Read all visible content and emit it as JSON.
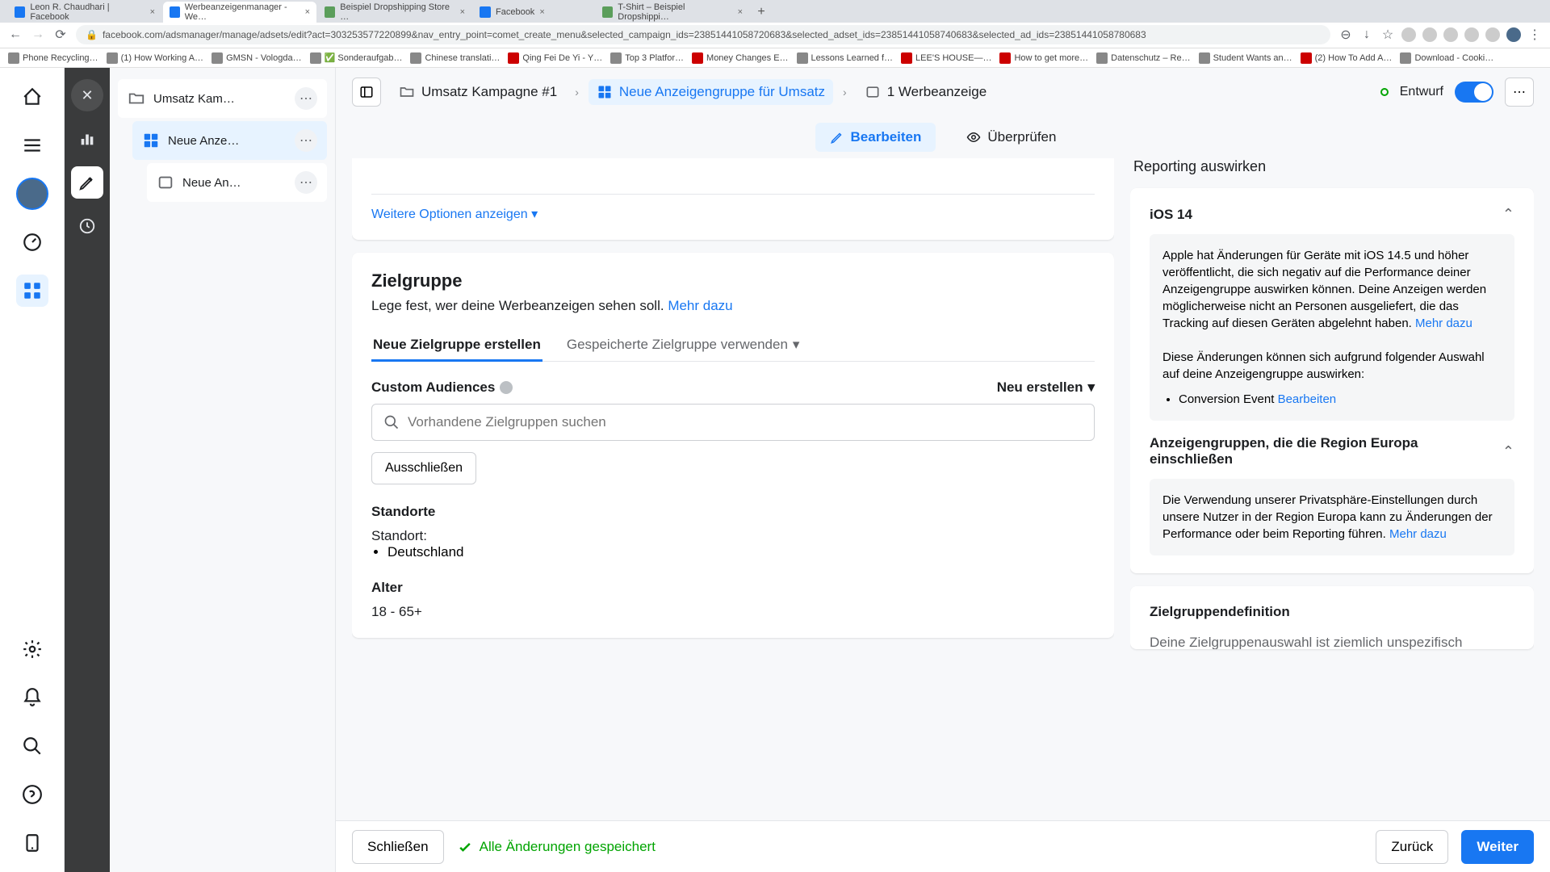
{
  "browser": {
    "tabs": [
      {
        "label": "Leon R. Chaudhari | Facebook",
        "favicon": "#1877f2"
      },
      {
        "label": "Werbeanzeigenmanager - We…",
        "favicon": "#1877f2"
      },
      {
        "label": "Beispiel Dropshipping Store …",
        "favicon": "#5b9e5b"
      },
      {
        "label": "Facebook",
        "favicon": "#1877f2"
      },
      {
        "label": "T-Shirt – Beispiel Dropshippi…",
        "favicon": "#5b9e5b"
      }
    ],
    "url": "facebook.com/adsmanager/manage/adsets/edit?act=303253577220899&nav_entry_point=comet_create_menu&selected_campaign_ids=23851441058720683&selected_adset_ids=23851441058740683&selected_ad_ids=23851441058780683",
    "bookmarks": [
      "Phone Recycling…",
      "(1) How Working A…",
      "GMSN - Vologda…",
      "✅ Sonderaufgab…",
      "Chinese translati…",
      "Qing Fei De Yi - Y…",
      "Top 3 Platfor…",
      "Money Changes E…",
      "Lessons Learned f…",
      "LEE'S HOUSE—…",
      "How to get more…",
      "Datenschutz – Re…",
      "Student Wants an…",
      "(2) How To Add A…",
      "Download - Cooki…"
    ]
  },
  "leftRail": {
    "icons": [
      "home",
      "menu",
      "avatar",
      "dashboard",
      "grid",
      "settings",
      "bell",
      "search",
      "help",
      "mobile"
    ]
  },
  "tree": {
    "items": [
      {
        "label": "Umsatz Kam…",
        "icon": "folder"
      },
      {
        "label": "Neue Anze…",
        "icon": "adset"
      },
      {
        "label": "Neue An…",
        "icon": "ad"
      }
    ]
  },
  "breadcrumb": {
    "items": [
      {
        "label": "Umsatz Kampagne #1",
        "icon": "folder"
      },
      {
        "label": "Neue Anzeigengruppe für Umsatz",
        "icon": "adset",
        "active": true
      },
      {
        "label": "1 Werbeanzeige",
        "icon": "ad"
      }
    ],
    "status": "Entwurf",
    "toggle": true
  },
  "modeTabs": {
    "edit": "Bearbeiten",
    "review": "Überprüfen"
  },
  "moreOptions": "Weitere Optionen anzeigen",
  "audience": {
    "title": "Zielgruppe",
    "desc": "Lege fest, wer deine Werbeanzeigen sehen soll. ",
    "learnMore": "Mehr dazu",
    "tabNew": "Neue Zielgruppe erstellen",
    "tabSaved": "Gespeicherte Zielgruppe verwenden",
    "customLabel": "Custom Audiences",
    "newCreate": "Neu erstellen",
    "searchPlaceholder": "Vorhandene Zielgruppen suchen",
    "exclude": "Ausschließen",
    "locationsLabel": "Standorte",
    "locationKey": "Standort:",
    "locationVal": "Deutschland",
    "ageLabel": "Alter",
    "ageVal": "18 - 65+"
  },
  "side": {
    "reportingPeek": "Reporting auswirken",
    "ios": {
      "title": "iOS 14",
      "body1": "Apple hat Änderungen für Geräte mit iOS 14.5 und höher veröffentlicht, die sich negativ auf die Performance deiner Anzeigengruppe auswirken können. Deine Anzeigen werden möglicherweise nicht an Personen ausgeliefert, die das Tracking auf diesen Geräten abgelehnt haben. ",
      "learnMore": "Mehr dazu",
      "body2": "Diese Änderungen können sich aufgrund folgender Auswahl auf deine Anzeigengruppe auswirken:",
      "bullet": "Conversion Event ",
      "editLink": "Bearbeiten"
    },
    "europe": {
      "title": "Anzeigengruppen, die die Region Europa einschließen",
      "body": "Die Verwendung unserer Privatsphäre-Einstellungen durch unsere Nutzer in der Region Europa kann zu Änderungen der Performance oder beim Reporting führen. ",
      "learnMore": "Mehr dazu"
    },
    "definition": {
      "title": "Zielgruppendefinition",
      "peek": "Deine Zielgruppenauswahl ist ziemlich unspezifisch"
    }
  },
  "footer": {
    "close": "Schließen",
    "saved": "Alle Änderungen gespeichert",
    "back": "Zurück",
    "next": "Weiter"
  }
}
